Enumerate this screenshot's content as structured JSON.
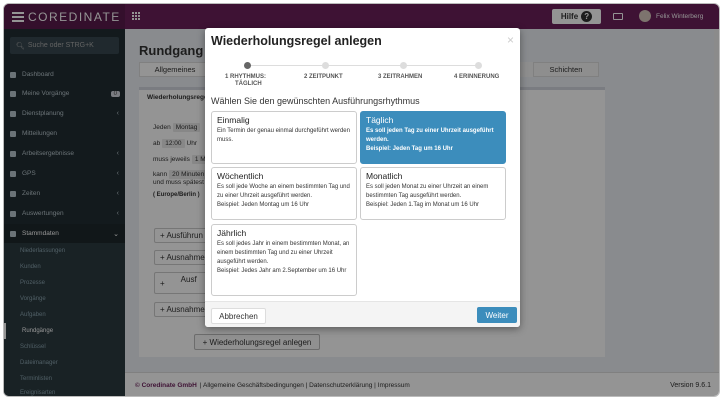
{
  "brand": {
    "name": "COREDINATE"
  },
  "topbar": {
    "help_label": "Hilfe",
    "user_name": "Felix Winterberg"
  },
  "sidebar": {
    "search_placeholder": "Suche oder STRG+K",
    "items": [
      {
        "label": "Dashboard",
        "icon": "dashboard-icon"
      },
      {
        "label": "Meine Vorgänge",
        "icon": "list-icon",
        "badge": "0"
      },
      {
        "label": "Dienstplanung",
        "icon": "calendar-icon",
        "chevron": "‹"
      },
      {
        "label": "Mitteilungen",
        "icon": "envelope-icon"
      },
      {
        "label": "Arbeitsergebnisse",
        "icon": "monitor-icon",
        "chevron": "‹"
      },
      {
        "label": "GPS",
        "icon": "location-icon",
        "chevron": "‹"
      },
      {
        "label": "Zeiten",
        "icon": "clock-icon",
        "chevron": "‹"
      },
      {
        "label": "Auswertungen",
        "icon": "chart-icon",
        "chevron": "‹"
      },
      {
        "label": "Stammdaten",
        "icon": "database-icon",
        "chevron": "⌄"
      }
    ],
    "subitems": [
      "Niederlassungen",
      "Kunden",
      "Prozesse",
      "Vorgänge",
      "Aufgaben",
      "Rundgänge",
      "Schlüssel",
      "Dateimanager",
      "Terminlisten",
      "Ereignisarten"
    ]
  },
  "page": {
    "title": "Rundgang",
    "tab_general": "Allgemeines",
    "tab_shifts": "Schichten",
    "panel_heading": "Wiederholungsrege",
    "row1_a": "Jeden",
    "row1_b": "Montag",
    "row2_a": "ab",
    "row2_b": "12:00",
    "row2_c": "Uhr",
    "row3_a": "muss jeweils",
    "row3_b": "1 M",
    "row4_a": "kann",
    "row4_b": "20 Minuten",
    "row5": "und muss spätest",
    "timezone": "( Europe/Berlin )",
    "btn1": "+ Ausführun",
    "btn2": "+ Ausnahme",
    "btn3a": "Ausf",
    "btn3b": "+",
    "btn4": "+ Ausnahme",
    "add_rule_button": "+ Wiederholungsregel anlegen"
  },
  "footer": {
    "company": "© Coredinate GmbH",
    "links": "| Allgemeine Geschäftsbedingungen | Datenschutzerklärung | Impressum",
    "version": "Version 9.6.1"
  },
  "modal": {
    "title": "Wiederholungsregel anlegen",
    "close": "×",
    "steps": [
      {
        "label1": "1  RHYTHMUS:",
        "label2": "TÄGLICH",
        "current": true
      },
      {
        "label1": "2  ZEITPUNKT",
        "label2": ""
      },
      {
        "label1": "3  ZEITRAHMEN",
        "label2": ""
      },
      {
        "label1": "4  ERINNERUNG",
        "label2": ""
      }
    ],
    "subtitle": "Wählen Sie den gewünschten Ausführungsrhythmus",
    "options": [
      {
        "title": "Einmalig",
        "desc": "Ein Termin der genau einmal durchgeführt werden muss.",
        "example": ""
      },
      {
        "title": "Täglich",
        "desc": "Es soll jeden Tag zu einer Uhrzeit ausgeführt werden.",
        "example": "Beispiel: Jeden Tag um 16 Uhr",
        "selected": true
      },
      {
        "title": "Wöchentlich",
        "desc": "Es soll jede Woche an einem bestimmten Tag und zu einer Uhrzeit ausgeführt werden.",
        "example": "Beispiel: Jeden Montag um 16 Uhr"
      },
      {
        "title": "Monatlich",
        "desc": "Es soll jeden Monat zu einer Uhrzeit an einem bestimmten Tag ausgeführt werden.",
        "example": "Beispiel: Jeden 1.Tag im Monat um 16 Uhr"
      },
      {
        "title": "Jährlich",
        "desc": "Es soll jedes Jahr in einem bestimmten Monat, an einem bestimmten Tag und zu einer Uhrzeit ausgeführt werden.",
        "example": "Beispiel: Jedes Jahr am 2.September um 16 Uhr"
      }
    ],
    "cancel_label": "Abbrechen",
    "next_label": "Weiter"
  },
  "colors": {
    "topbar": "#6b1f5a",
    "sidebar": "#222d32",
    "accent": "#3c8dbc"
  }
}
